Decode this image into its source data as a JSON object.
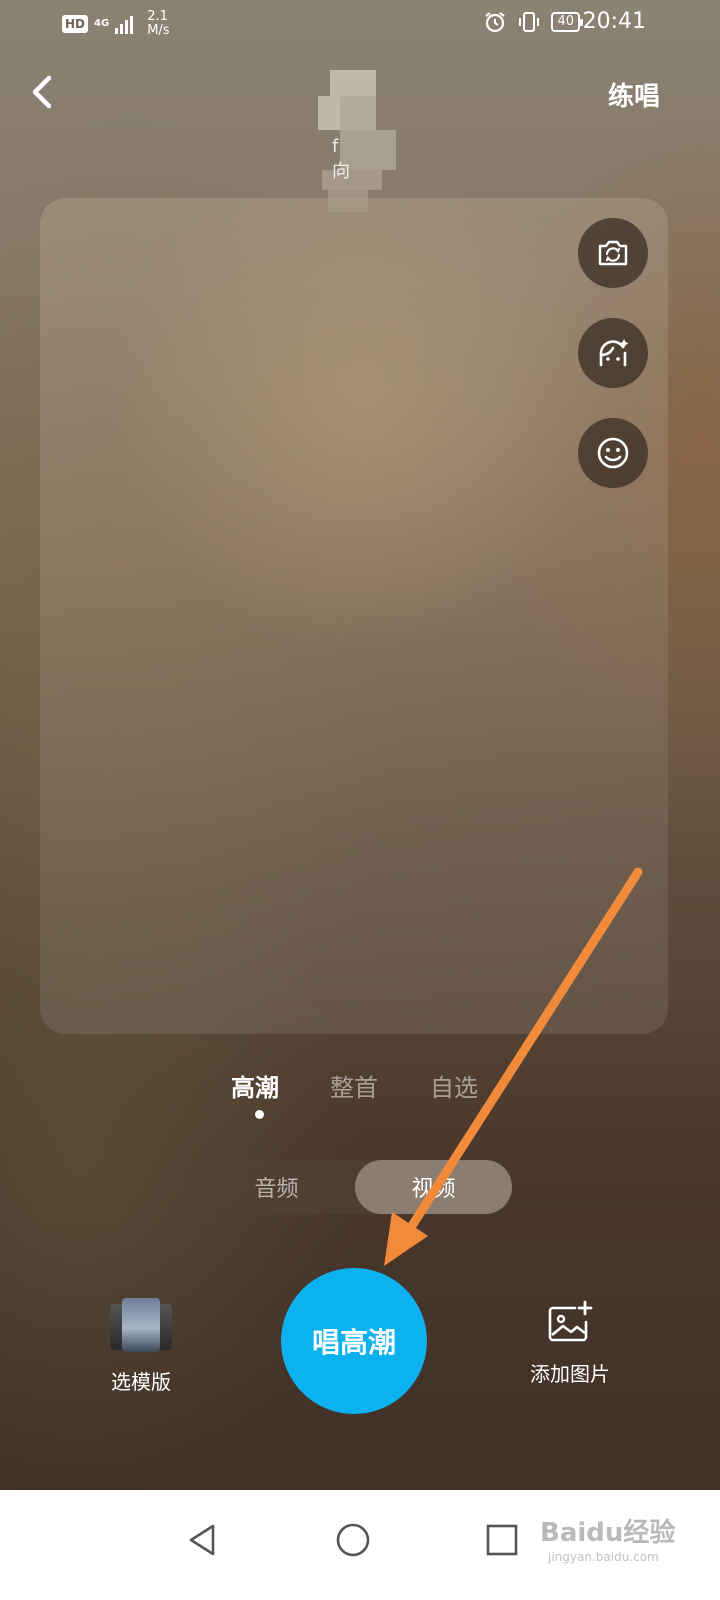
{
  "status_bar": {
    "hd": "HD",
    "network": "4G",
    "speed_value": "2.1",
    "speed_unit": "M/s",
    "battery": "40",
    "time": "20:41"
  },
  "header": {
    "practice_label": "练唱",
    "cover_text": "f 向"
  },
  "mode_tabs": [
    {
      "label": "高潮",
      "active": true
    },
    {
      "label": "整首",
      "active": false
    },
    {
      "label": "自选",
      "active": false
    }
  ],
  "media_toggle": {
    "audio_label": "音频",
    "video_label": "视频",
    "selected": "视频"
  },
  "bottom": {
    "template_label": "选模版",
    "sing_label": "唱高潮",
    "add_image_label": "添加图片"
  },
  "colors": {
    "sing_button": "#0cb2f0",
    "annotation_arrow": "#f28a3c"
  },
  "watermark": {
    "brand": "Baidu经验",
    "url": "jingyan.baidu.com"
  }
}
